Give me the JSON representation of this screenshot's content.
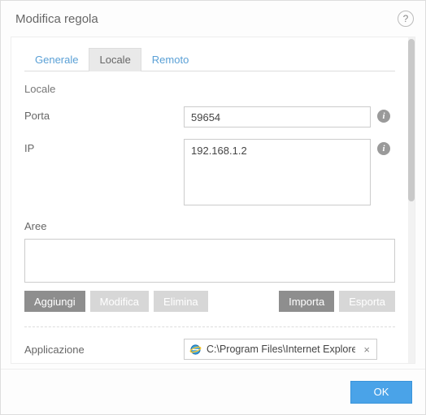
{
  "window": {
    "title": "Modifica regola"
  },
  "tabs": {
    "items": [
      {
        "label": "Generale"
      },
      {
        "label": "Locale",
        "active": true
      },
      {
        "label": "Remoto"
      }
    ]
  },
  "section": {
    "title": "Locale"
  },
  "fields": {
    "port": {
      "label": "Porta",
      "value": "59654"
    },
    "ip": {
      "label": "IP",
      "value": "192.168.1.2"
    },
    "areas": {
      "label": "Aree"
    },
    "application": {
      "label": "Applicazione",
      "value": "C:\\Program Files\\Internet Explorer\\"
    }
  },
  "buttons": {
    "add": "Aggiungi",
    "modify": "Modifica",
    "delete": "Elimina",
    "import": "Importa",
    "export": "Esporta",
    "ok": "OK"
  },
  "icons": {
    "help": "?",
    "info": "i",
    "clear": "×"
  }
}
